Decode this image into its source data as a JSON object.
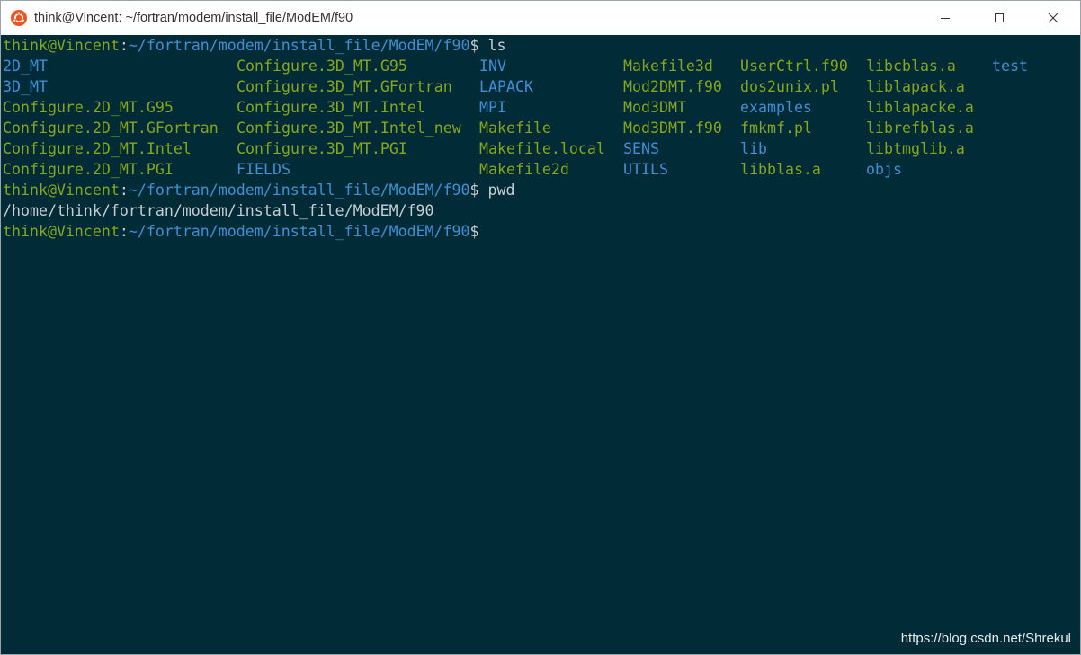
{
  "window": {
    "title": "think@Vincent: ~/fortran/modem/install_file/ModEM/f90",
    "app_icon": "ubuntu-icon",
    "controls": [
      "minimize-icon",
      "maximize-icon",
      "close-icon"
    ]
  },
  "colors": {
    "background": "#012b36",
    "prompt_user": "#87a61b",
    "prompt_path": "#3f8fd6",
    "text": "#c8ced3",
    "file": "#87a61b",
    "directory": "#3f8fd6"
  },
  "prompt": {
    "user_host": "think@Vincent",
    "separator": ":",
    "path": "~/fortran/modem/install_file/ModEM/f90",
    "symbol": "$"
  },
  "commands": {
    "first": " ls",
    "second": " pwd"
  },
  "ls_listing": [
    [
      {
        "name": "2D_MT",
        "kind": "dir"
      },
      {
        "name": "Configure.3D_MT.G95",
        "kind": "file"
      },
      {
        "name": "INV",
        "kind": "dir"
      },
      {
        "name": "Makefile3d",
        "kind": "file"
      },
      {
        "name": "UserCtrl.f90",
        "kind": "file"
      },
      {
        "name": "libcblas.a",
        "kind": "file"
      },
      {
        "name": "test",
        "kind": "dir"
      }
    ],
    [
      {
        "name": "3D_MT",
        "kind": "dir"
      },
      {
        "name": "Configure.3D_MT.GFortran",
        "kind": "file"
      },
      {
        "name": "LAPACK",
        "kind": "dir"
      },
      {
        "name": "Mod2DMT.f90",
        "kind": "file"
      },
      {
        "name": "dos2unix.pl",
        "kind": "file"
      },
      {
        "name": "liblapack.a",
        "kind": "file"
      }
    ],
    [
      {
        "name": "Configure.2D_MT.G95",
        "kind": "file"
      },
      {
        "name": "Configure.3D_MT.Intel",
        "kind": "file"
      },
      {
        "name": "MPI",
        "kind": "dir"
      },
      {
        "name": "Mod3DMT",
        "kind": "file"
      },
      {
        "name": "examples",
        "kind": "dir"
      },
      {
        "name": "liblapacke.a",
        "kind": "file"
      }
    ],
    [
      {
        "name": "Configure.2D_MT.GFortran",
        "kind": "file"
      },
      {
        "name": "Configure.3D_MT.Intel_new",
        "kind": "file"
      },
      {
        "name": "Makefile",
        "kind": "file"
      },
      {
        "name": "Mod3DMT.f90",
        "kind": "file"
      },
      {
        "name": "fmkmf.pl",
        "kind": "file"
      },
      {
        "name": "librefblas.a",
        "kind": "file"
      }
    ],
    [
      {
        "name": "Configure.2D_MT.Intel",
        "kind": "file"
      },
      {
        "name": "Configure.3D_MT.PGI",
        "kind": "file"
      },
      {
        "name": "Makefile.local",
        "kind": "file"
      },
      {
        "name": "SENS",
        "kind": "dir"
      },
      {
        "name": "lib",
        "kind": "dir"
      },
      {
        "name": "libtmglib.a",
        "kind": "file"
      }
    ],
    [
      {
        "name": "Configure.2D_MT.PGI",
        "kind": "file"
      },
      {
        "name": "FIELDS",
        "kind": "dir"
      },
      {
        "name": "Makefile2d",
        "kind": "file"
      },
      {
        "name": "UTILS",
        "kind": "dir"
      },
      {
        "name": "libblas.a",
        "kind": "file"
      },
      {
        "name": "objs",
        "kind": "dir"
      }
    ]
  ],
  "pwd_output": "/home/think/fortran/modem/install_file/ModEM/f90",
  "watermark": "https://blog.csdn.net/Shrekul"
}
